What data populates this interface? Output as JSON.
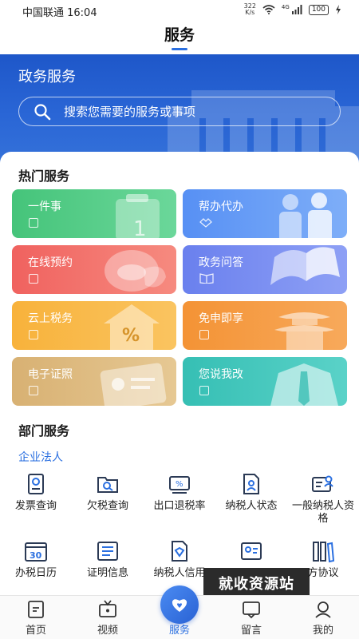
{
  "status_bar": {
    "carrier_time": "中国联通 16:04",
    "speed_value": "322",
    "speed_unit": "K/s",
    "network": "4G",
    "battery": "100"
  },
  "header": {
    "title": "服务"
  },
  "banner": {
    "title": "政务服务",
    "search_placeholder": "搜索您需要的服务或事项"
  },
  "hot_services": {
    "title": "热门服务",
    "tiles": [
      {
        "label": "一件事",
        "color": "#4cc980"
      },
      {
        "label": "帮办代办",
        "color": "#5b96f5"
      },
      {
        "label": "在线预约",
        "color": "#f26c6a"
      },
      {
        "label": "政务问答",
        "color": "#6f86f2"
      },
      {
        "label": "云上税务",
        "color": "#f9b546"
      },
      {
        "label": "免申即享",
        "color": "#f59a44"
      },
      {
        "label": "电子证照",
        "color": "#dcb77b"
      },
      {
        "label": "您说我改",
        "color": "#3fc6bb"
      }
    ]
  },
  "dept_services": {
    "title": "部门服务",
    "subtitle": "企业法人",
    "items": [
      {
        "label": "发票查询"
      },
      {
        "label": "欠税查询"
      },
      {
        "label": "出口退税率"
      },
      {
        "label": "纳税人状态"
      },
      {
        "label": "一般纳税人资格"
      },
      {
        "label": "办税日历"
      },
      {
        "label": "证明信息"
      },
      {
        "label": "纳税人信用"
      },
      {
        "label": ""
      },
      {
        "label": "方协议"
      }
    ]
  },
  "bottom_nav": {
    "items": [
      {
        "label": "首页"
      },
      {
        "label": "视频"
      },
      {
        "label": "服务"
      },
      {
        "label": "留言"
      },
      {
        "label": "我的"
      }
    ]
  },
  "watermark": "就收资源站",
  "colors": {
    "accent": "#2a6fe0",
    "banner": "#2460d0"
  }
}
